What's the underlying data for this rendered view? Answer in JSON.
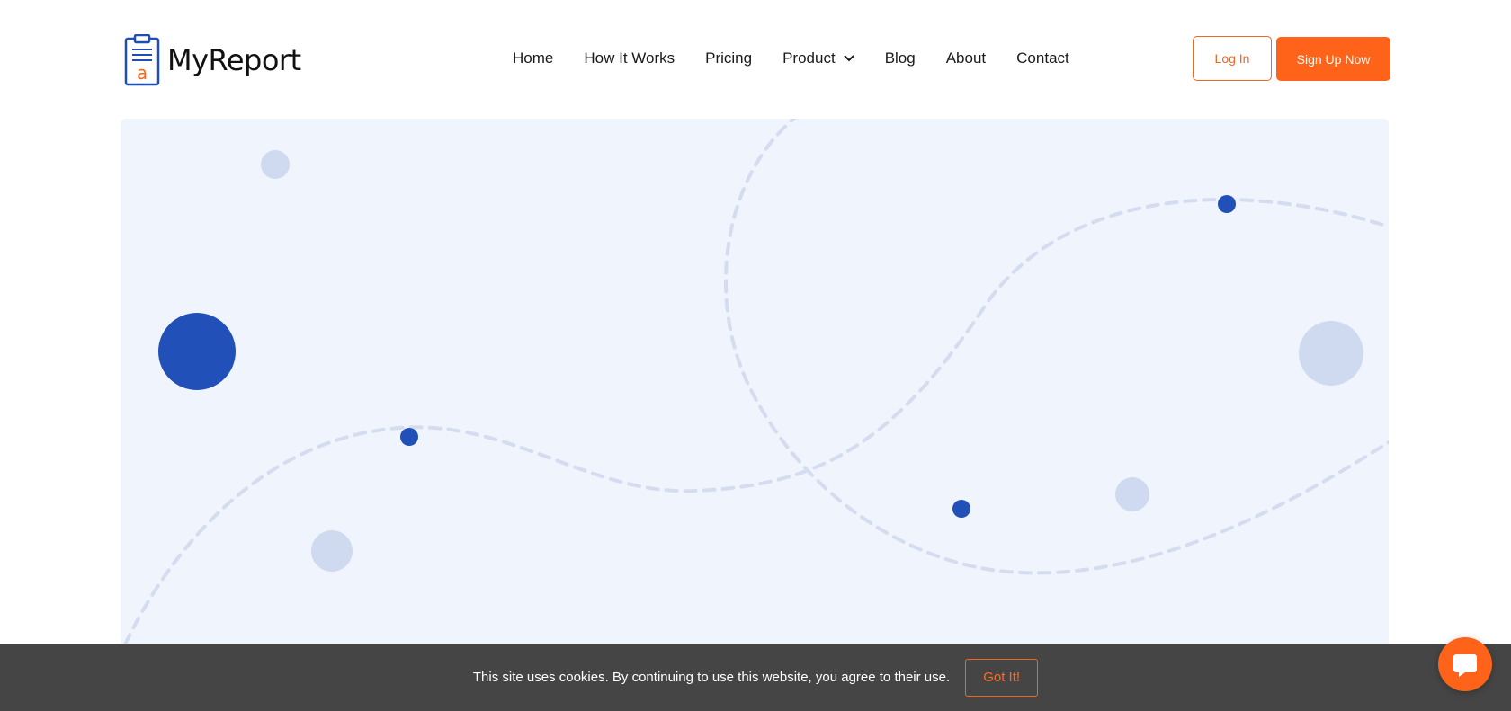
{
  "brand": {
    "name": "MyReport",
    "icon_letter": "a",
    "primary_color": "#1f4fb5",
    "accent_color": "#ff6319"
  },
  "nav": {
    "items": [
      {
        "label": "Home"
      },
      {
        "label": "How It Works"
      },
      {
        "label": "Pricing"
      },
      {
        "label": "Product",
        "has_dropdown": true
      },
      {
        "label": "Blog"
      },
      {
        "label": "About"
      },
      {
        "label": "Contact"
      }
    ]
  },
  "auth": {
    "login_label": "Log In",
    "signup_label": "Sign Up Now"
  },
  "hero": {
    "background": "#f0f4fc",
    "dot_dark": "#2150b8",
    "dot_light": "#cfdaf0"
  },
  "cookie": {
    "text": "This site uses cookies. By continuing to use this website, you agree to their use.",
    "button_label": "Got It!"
  },
  "chat": {
    "icon": "chat-bubble-icon"
  }
}
